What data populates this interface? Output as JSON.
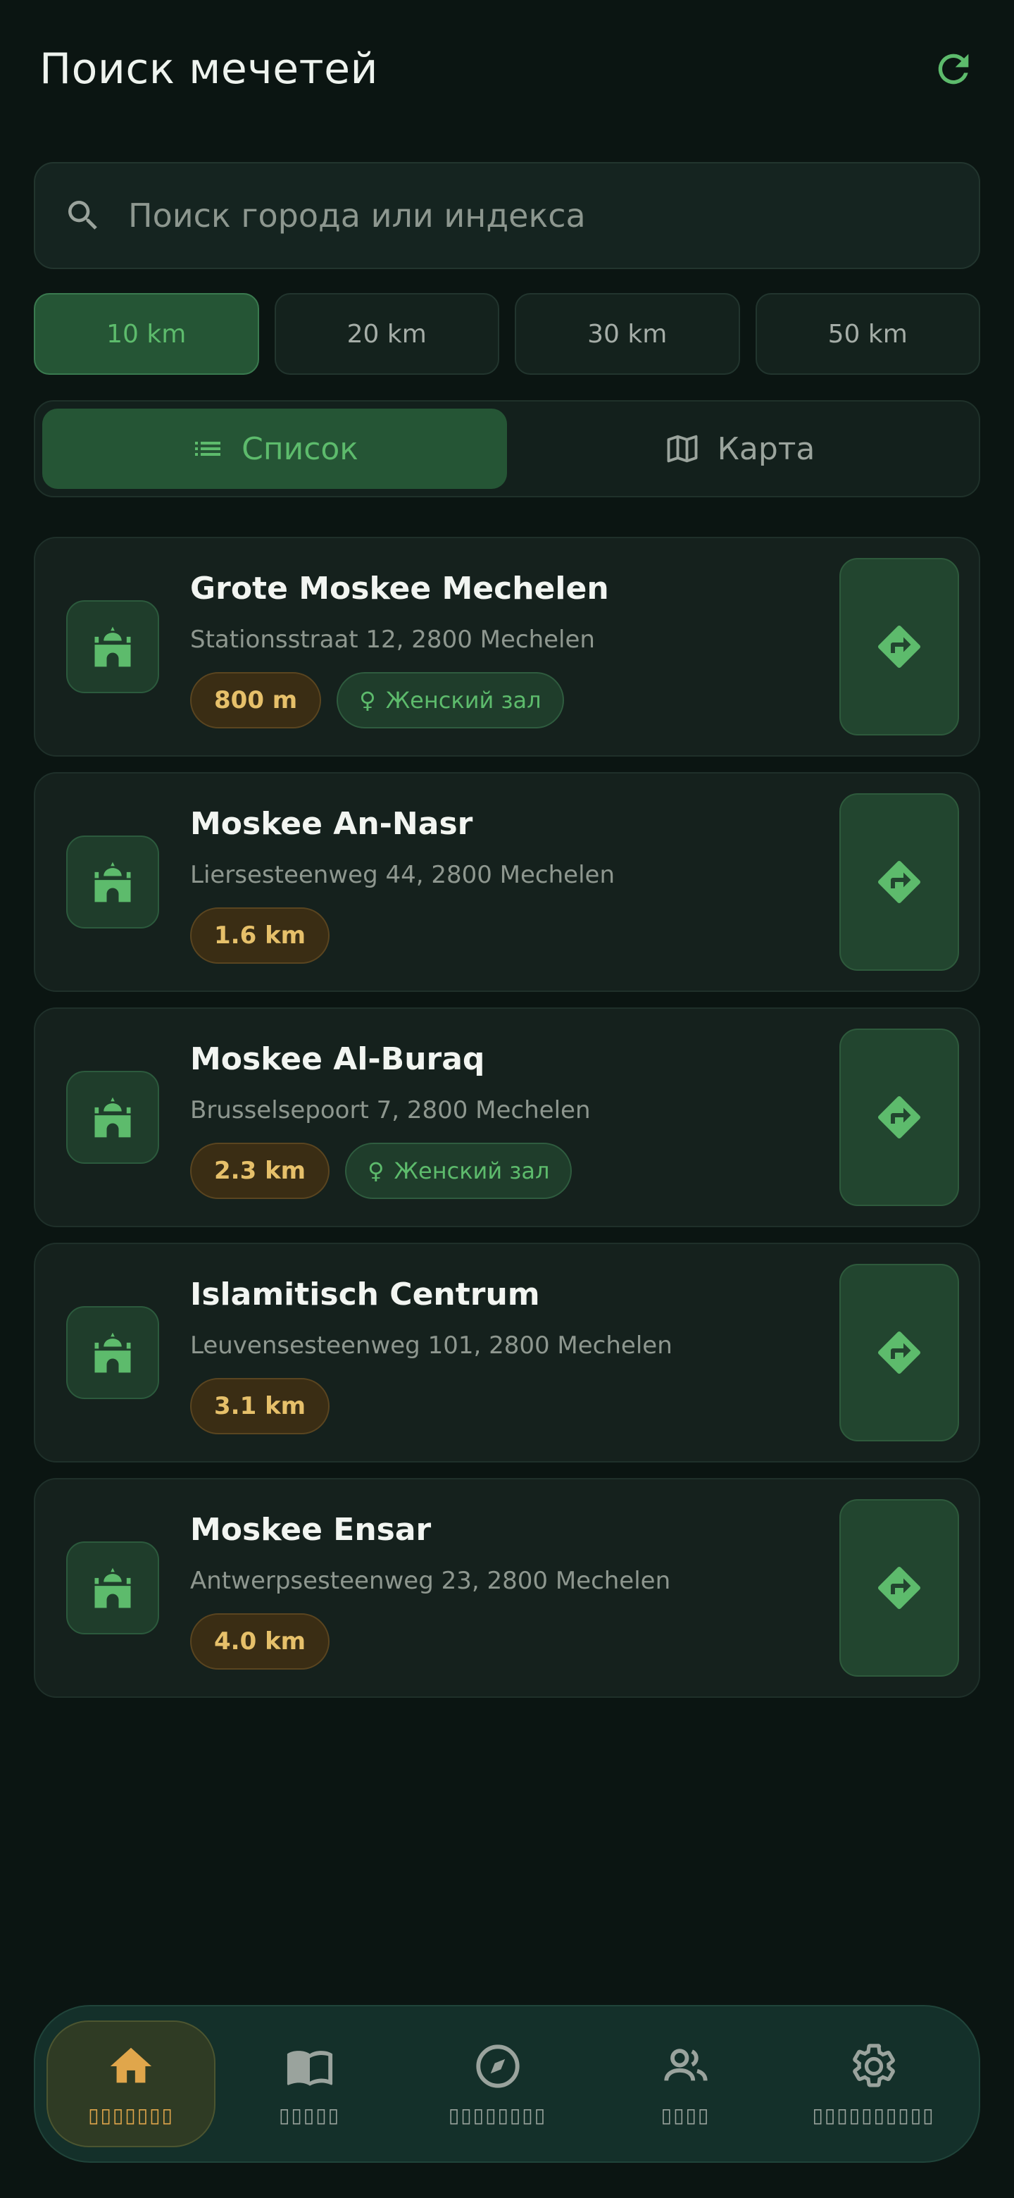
{
  "header": {
    "title": "Поиск мечетей",
    "refresh_icon": "refresh-icon"
  },
  "search": {
    "placeholder": "Поиск города или индекса",
    "value": ""
  },
  "radius_options": [
    {
      "label": "10 km",
      "selected": true
    },
    {
      "label": "20 km",
      "selected": false
    },
    {
      "label": "30 km",
      "selected": false
    },
    {
      "label": "50 km",
      "selected": false
    }
  ],
  "view_toggle": {
    "list_label": "Список",
    "map_label": "Карта",
    "selected": "list"
  },
  "mosques": [
    {
      "name": "Grote Moskee Mechelen",
      "address": "Stationsstraat 12, 2800 Mechelen",
      "distance": "800 m",
      "women_hall": "Женский зал"
    },
    {
      "name": "Moskee An-Nasr",
      "address": "Liersesteenweg 44, 2800 Mechelen",
      "distance": "1.6 km",
      "women_hall": null
    },
    {
      "name": "Moskee Al-Buraq",
      "address": "Brusselsepoort 7, 2800 Mechelen",
      "distance": "2.3 km",
      "women_hall": "Женский зал"
    },
    {
      "name": "Islamitisch Centrum",
      "address": "Leuvensesteenweg 101, 2800 Mechelen",
      "distance": "3.1 km",
      "women_hall": null
    },
    {
      "name": "Moskee Ensar",
      "address": "Antwerpsesteenweg 23, 2800 Mechelen",
      "distance": "4.0 km",
      "women_hall": null
    }
  ],
  "bottom_nav": {
    "items": [
      {
        "label": "▯▯▯▯▯▯▯",
        "icon": "home-icon",
        "active": true
      },
      {
        "label": "▯▯▯▯▯",
        "icon": "book-icon",
        "active": false
      },
      {
        "label": "▯▯▯▯▯▯▯▯",
        "icon": "compass-icon",
        "active": false
      },
      {
        "label": "▯▯▯▯",
        "icon": "people-icon",
        "active": false
      },
      {
        "label": "▯▯▯▯▯▯▯▯▯▯",
        "icon": "settings-icon",
        "active": false
      }
    ]
  },
  "colors": {
    "background": "#0b1512",
    "accent_green": "#5dbb6c",
    "distance_gold": "#e6c06a",
    "nav_active": "#e0a64b"
  }
}
